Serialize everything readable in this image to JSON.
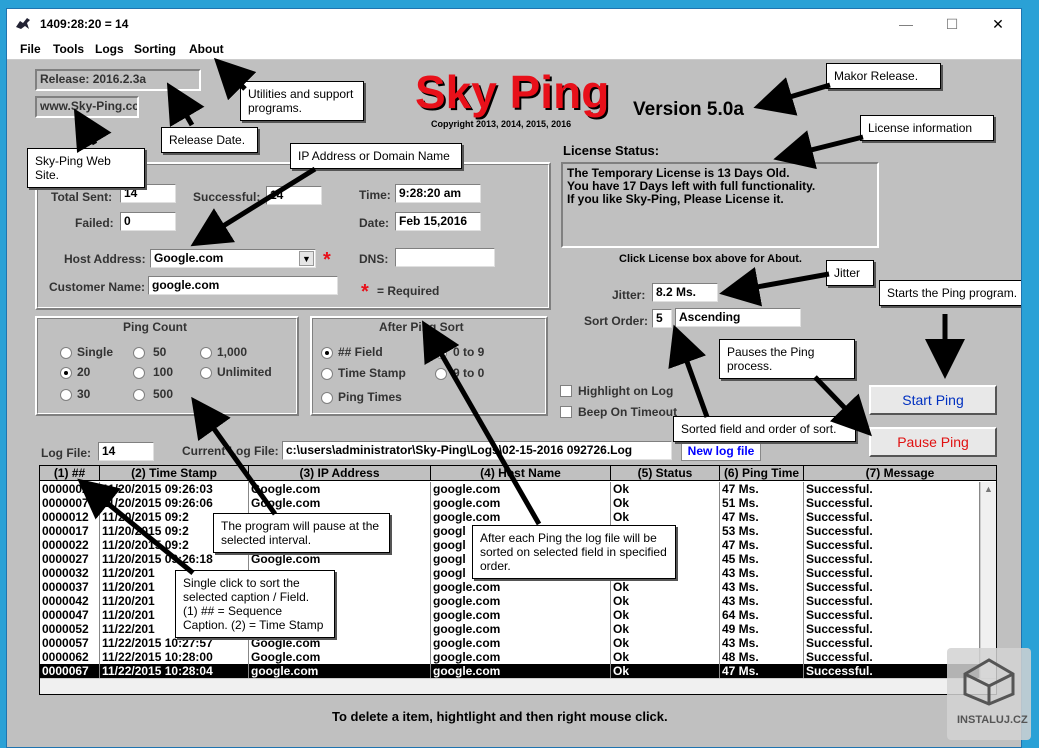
{
  "window": {
    "title": "1409:28:20  =  14",
    "controls": [
      "—",
      "☐",
      "✕"
    ]
  },
  "menu": [
    "File",
    "Tools",
    "Logs",
    "Sorting",
    "About"
  ],
  "release": "Release:  2016.2.3a",
  "website": "www.Sky-Ping.cc",
  "logo": {
    "title": "Sky Ping",
    "version": "Version 5.0a",
    "copyright": "Copyright 2013, 2014, 2015, 2016"
  },
  "license": {
    "label": "License Status:",
    "lines": [
      "The Temporary License is 13 Days Old.",
      "You have 17 Days left with full functionality.",
      "If you like Sky-Ping, Please License it."
    ],
    "hint": "Click License box above for About."
  },
  "stats": {
    "total_sent_label": "Total Sent:",
    "total_sent": "14",
    "successful_label": "Successful:",
    "successful": "14",
    "failed_label": "Failed:",
    "failed": "0",
    "time_label": "Time:",
    "time": "9:28:20 am",
    "date_label": "Date:",
    "date": "Feb 15,2016",
    "host_label": "Host Address:",
    "host": "Google.com",
    "dns_label": "DNS:",
    "dns": "",
    "customer_label": "Customer Name:",
    "customer": "google.com",
    "required_star": "*",
    "required_label": "= Required"
  },
  "ping_count": {
    "title": "Ping Count",
    "options": [
      "Single",
      "50",
      "1,000",
      "20",
      "100",
      "Unlimited",
      "30",
      "500"
    ],
    "selected": "20"
  },
  "after_sort": {
    "title": "After Ping Sort",
    "fields": [
      "## Field",
      "Time Stamp",
      "Ping Times"
    ],
    "selected_field": "## Field",
    "orders": [
      "0 to 9",
      "9 to 0"
    ],
    "selected_order": "0 to 9"
  },
  "jitter_label": "Jitter:",
  "jitter": "8.2 Ms.",
  "sort_order_label": "Sort Order:",
  "sort_field": "5",
  "sort_dir": "Ascending",
  "highlight_label": "Highlight on Log",
  "beep_label": "Beep On Timeout",
  "start_button": "Start Ping",
  "pause_button": "Pause Ping",
  "log_file_label": "Log File:",
  "log_file": "14",
  "current_log_label": "Current Log File:",
  "current_log": "c:\\users\\administrator\\Sky-Ping\\Logs\\02-15-2016  092726.Log",
  "new_log_button": "New log file",
  "table": {
    "headers": [
      "(1) ##",
      "(2) Time Stamp",
      "(3) IP Address",
      "(4) Host Name",
      "(5) Status",
      "(6) Ping Time",
      "(7) Message"
    ],
    "rows": [
      [
        "0000002",
        "11/20/2015  09:26:03",
        "Google.com",
        "google.com",
        "Ok",
        "47 Ms.",
        "Successful."
      ],
      [
        "0000007",
        "11/20/2015  09:26:06",
        "Google.com",
        "google.com",
        "Ok",
        "51 Ms.",
        "Successful."
      ],
      [
        "0000012",
        "11/20/2015  09:2",
        "",
        "google.com",
        "Ok",
        "47 Ms.",
        "Successful."
      ],
      [
        "0000017",
        "11/20/2015  09:2",
        "",
        "googl",
        "",
        "53 Ms.",
        "Successful."
      ],
      [
        "0000022",
        "11/20/2015  09:2",
        "",
        "googl",
        "",
        "47 Ms.",
        "Successful."
      ],
      [
        "0000027",
        "11/20/2015  09:26:18",
        "Google.com",
        "googl",
        "",
        "45 Ms.",
        "Successful."
      ],
      [
        "0000032",
        "11/20/201",
        "",
        "googl",
        "",
        "43 Ms.",
        "Successful."
      ],
      [
        "0000037",
        "11/20/201",
        "",
        "google.com",
        "Ok",
        "43 Ms.",
        "Successful."
      ],
      [
        "0000042",
        "11/20/201",
        "",
        "google.com",
        "Ok",
        "43 Ms.",
        "Successful."
      ],
      [
        "0000047",
        "11/20/201",
        "",
        "google.com",
        "Ok",
        "64 Ms.",
        "Successful."
      ],
      [
        "0000052",
        "11/22/201",
        "",
        "google.com",
        "Ok",
        "49 Ms.",
        "Successful."
      ],
      [
        "0000057",
        "11/22/2015  10:27:57",
        "Google.com",
        "google.com",
        "Ok",
        "43 Ms.",
        "Successful."
      ],
      [
        "0000062",
        "11/22/2015  10:28:00",
        "Google.com",
        "google.com",
        "Ok",
        "48 Ms.",
        "Successful."
      ],
      [
        "0000067",
        "11/22/2015  10:28:04",
        "google.com",
        "google.com",
        "Ok",
        "47 Ms.",
        "Successful."
      ]
    ],
    "selected_row": 13
  },
  "footer_hint": "To delete a item, hightlight and then right mouse click.",
  "callouts": {
    "utilities": "Utilities and support programs.",
    "release_date": "Release Date.",
    "website": "Sky-Ping Web Site.",
    "ip_address": "IP Address or Domain Name",
    "major_release": "Makor Release.",
    "license_info": "License information",
    "jitter": "Jitter",
    "starts": "Starts the Ping program.",
    "pauses": "Pauses the Ping process.",
    "sorted": "Sorted field and order of sort.",
    "pause_interval": "The program will pause at the selected interval.",
    "after_each": "After each Ping the log file will be sorted on selected field in specified order.",
    "single_click": "Single click to sort the selected caption / Field. (1) ## = Sequence Caption. (2) = Time Stamp"
  },
  "watermark": "INSTALUJ.CZ",
  "colors": {
    "logo_red": "#e8101a",
    "required_red": "#e8101a",
    "start_blue": "#0030c0",
    "pause_red": "#e01010",
    "new_log_blue": "#0000ff"
  }
}
